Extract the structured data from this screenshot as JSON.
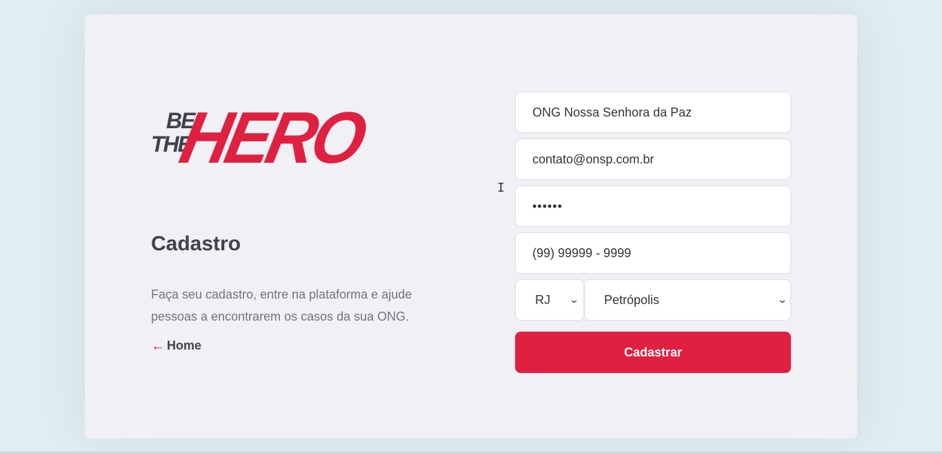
{
  "logo": {
    "be": "BE",
    "the": "THE",
    "hero": "HERO"
  },
  "page": {
    "title": "Cadastro",
    "description": "Faça seu cadastro, entre na plataforma e ajude pessoas a encontrarem os casos da sua ONG.",
    "back_link_label": "Home",
    "back_icon": "arrow-left-icon"
  },
  "form": {
    "name_value": "ONG Nossa Senhora da Paz",
    "email_value": "contato@onsp.com.br",
    "password_value": "••••••",
    "whatsapp_value": "(99) 99999 - 9999",
    "uf_value": "RJ",
    "city_value": "Petrópolis",
    "submit_label": "Cadastrar"
  },
  "colors": {
    "accent": "#e02041",
    "text_dark": "#41414d",
    "text_muted": "#737380",
    "card_bg": "#f0f0f5",
    "page_bg": "#e0eef3"
  }
}
